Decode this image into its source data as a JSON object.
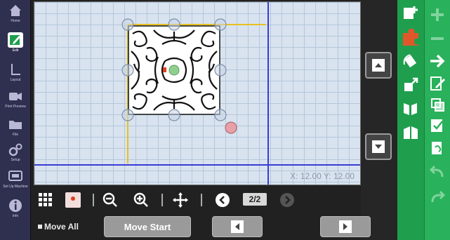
{
  "sidebar": {
    "items": [
      {
        "label": "Home"
      },
      {
        "label": "Edit"
      },
      {
        "label": "Layout"
      },
      {
        "label": "Print Preview"
      },
      {
        "label": "File"
      },
      {
        "label": "Setup"
      },
      {
        "label": "Set Up Machine"
      },
      {
        "label": "Info"
      }
    ]
  },
  "canvas": {
    "coordinate_readout": "X: 12.00 Y: 12.00"
  },
  "toolbar": {
    "page_indicator": "2/2"
  },
  "bottom": {
    "move_all_label": "Move All",
    "move_start_label": "Move Start"
  },
  "colors": {
    "sidebar": "#2f2f4f",
    "canvas": "#d8e3ef",
    "green_primary": "#1f9f4e",
    "green_secondary": "#29b15b",
    "guide_blue": "#3a3ad6",
    "guide_yellow": "#e8c020"
  }
}
